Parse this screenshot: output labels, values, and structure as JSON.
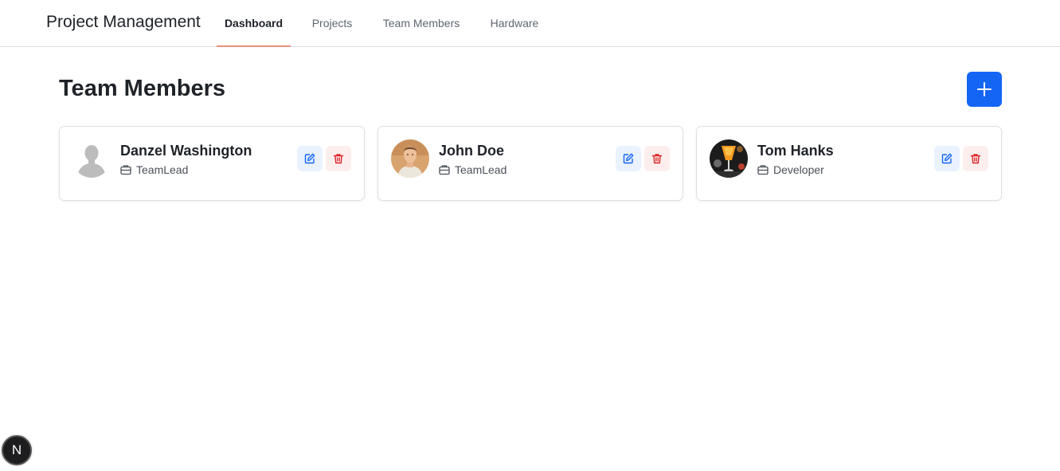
{
  "header": {
    "brand": "Project Management",
    "nav": [
      {
        "label": "Dashboard",
        "active": true
      },
      {
        "label": "Projects",
        "active": false
      },
      {
        "label": "Team Members",
        "active": false
      },
      {
        "label": "Hardware",
        "active": false
      }
    ]
  },
  "page": {
    "title": "Team Members",
    "add_button_icon": "plus-icon"
  },
  "members": [
    {
      "name": "Danzel Washington",
      "role": "TeamLead",
      "avatar": "silhouette-placeholder"
    },
    {
      "name": "John Doe",
      "role": "TeamLead",
      "avatar": "photo-man-white-shirt"
    },
    {
      "name": "Tom Hanks",
      "role": "Developer",
      "avatar": "photo-orange-drink"
    }
  ],
  "actions": {
    "edit_icon": "pencil-square-icon",
    "delete_icon": "trash-icon"
  },
  "badge": {
    "label": "N"
  },
  "colors": {
    "primary": "#1565f5",
    "nav_active_underline": "#e8927c",
    "edit_bg": "#eaf2ff",
    "edit_icon": "#1565f5",
    "delete_bg": "#fdeeee",
    "delete_icon": "#dc2626"
  }
}
